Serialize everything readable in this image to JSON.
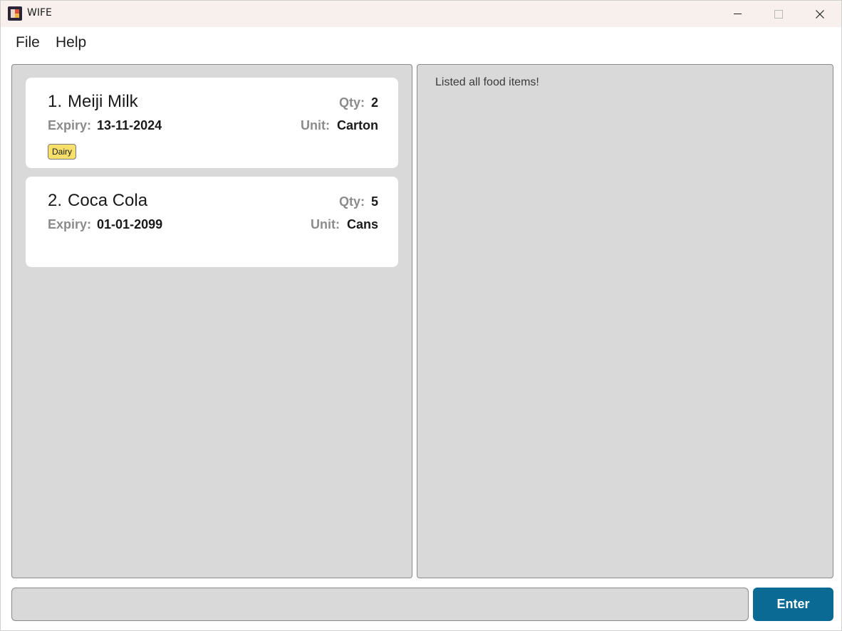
{
  "window": {
    "title": "WIFE",
    "controls": [
      "minimize-icon",
      "maximize-icon",
      "close-icon"
    ]
  },
  "menu": {
    "items": [
      {
        "label": "File"
      },
      {
        "label": "Help"
      }
    ]
  },
  "food_list": {
    "items": [
      {
        "index": "1.",
        "name": "Meiji Milk",
        "qty_label": "Qty:",
        "qty": "2",
        "expiry_label": "Expiry:",
        "expiry": "13-11-2024",
        "unit_label": "Unit:",
        "unit": "Carton",
        "tags": [
          "Dairy"
        ]
      },
      {
        "index": "2.",
        "name": "Coca Cola",
        "qty_label": "Qty:",
        "qty": "5",
        "expiry_label": "Expiry:",
        "expiry": "01-01-2099",
        "unit_label": "Unit:",
        "unit": "Cans",
        "tags": []
      }
    ]
  },
  "result": {
    "message": "Listed all food items!"
  },
  "command": {
    "value": "",
    "placeholder": "",
    "button_label": "Enter"
  },
  "colors": {
    "titlebar": "#f7f0ec",
    "panel": "#d9d9d9",
    "card": "#ffffff",
    "tag": "#f7e06a",
    "button": "#0b6a93"
  }
}
